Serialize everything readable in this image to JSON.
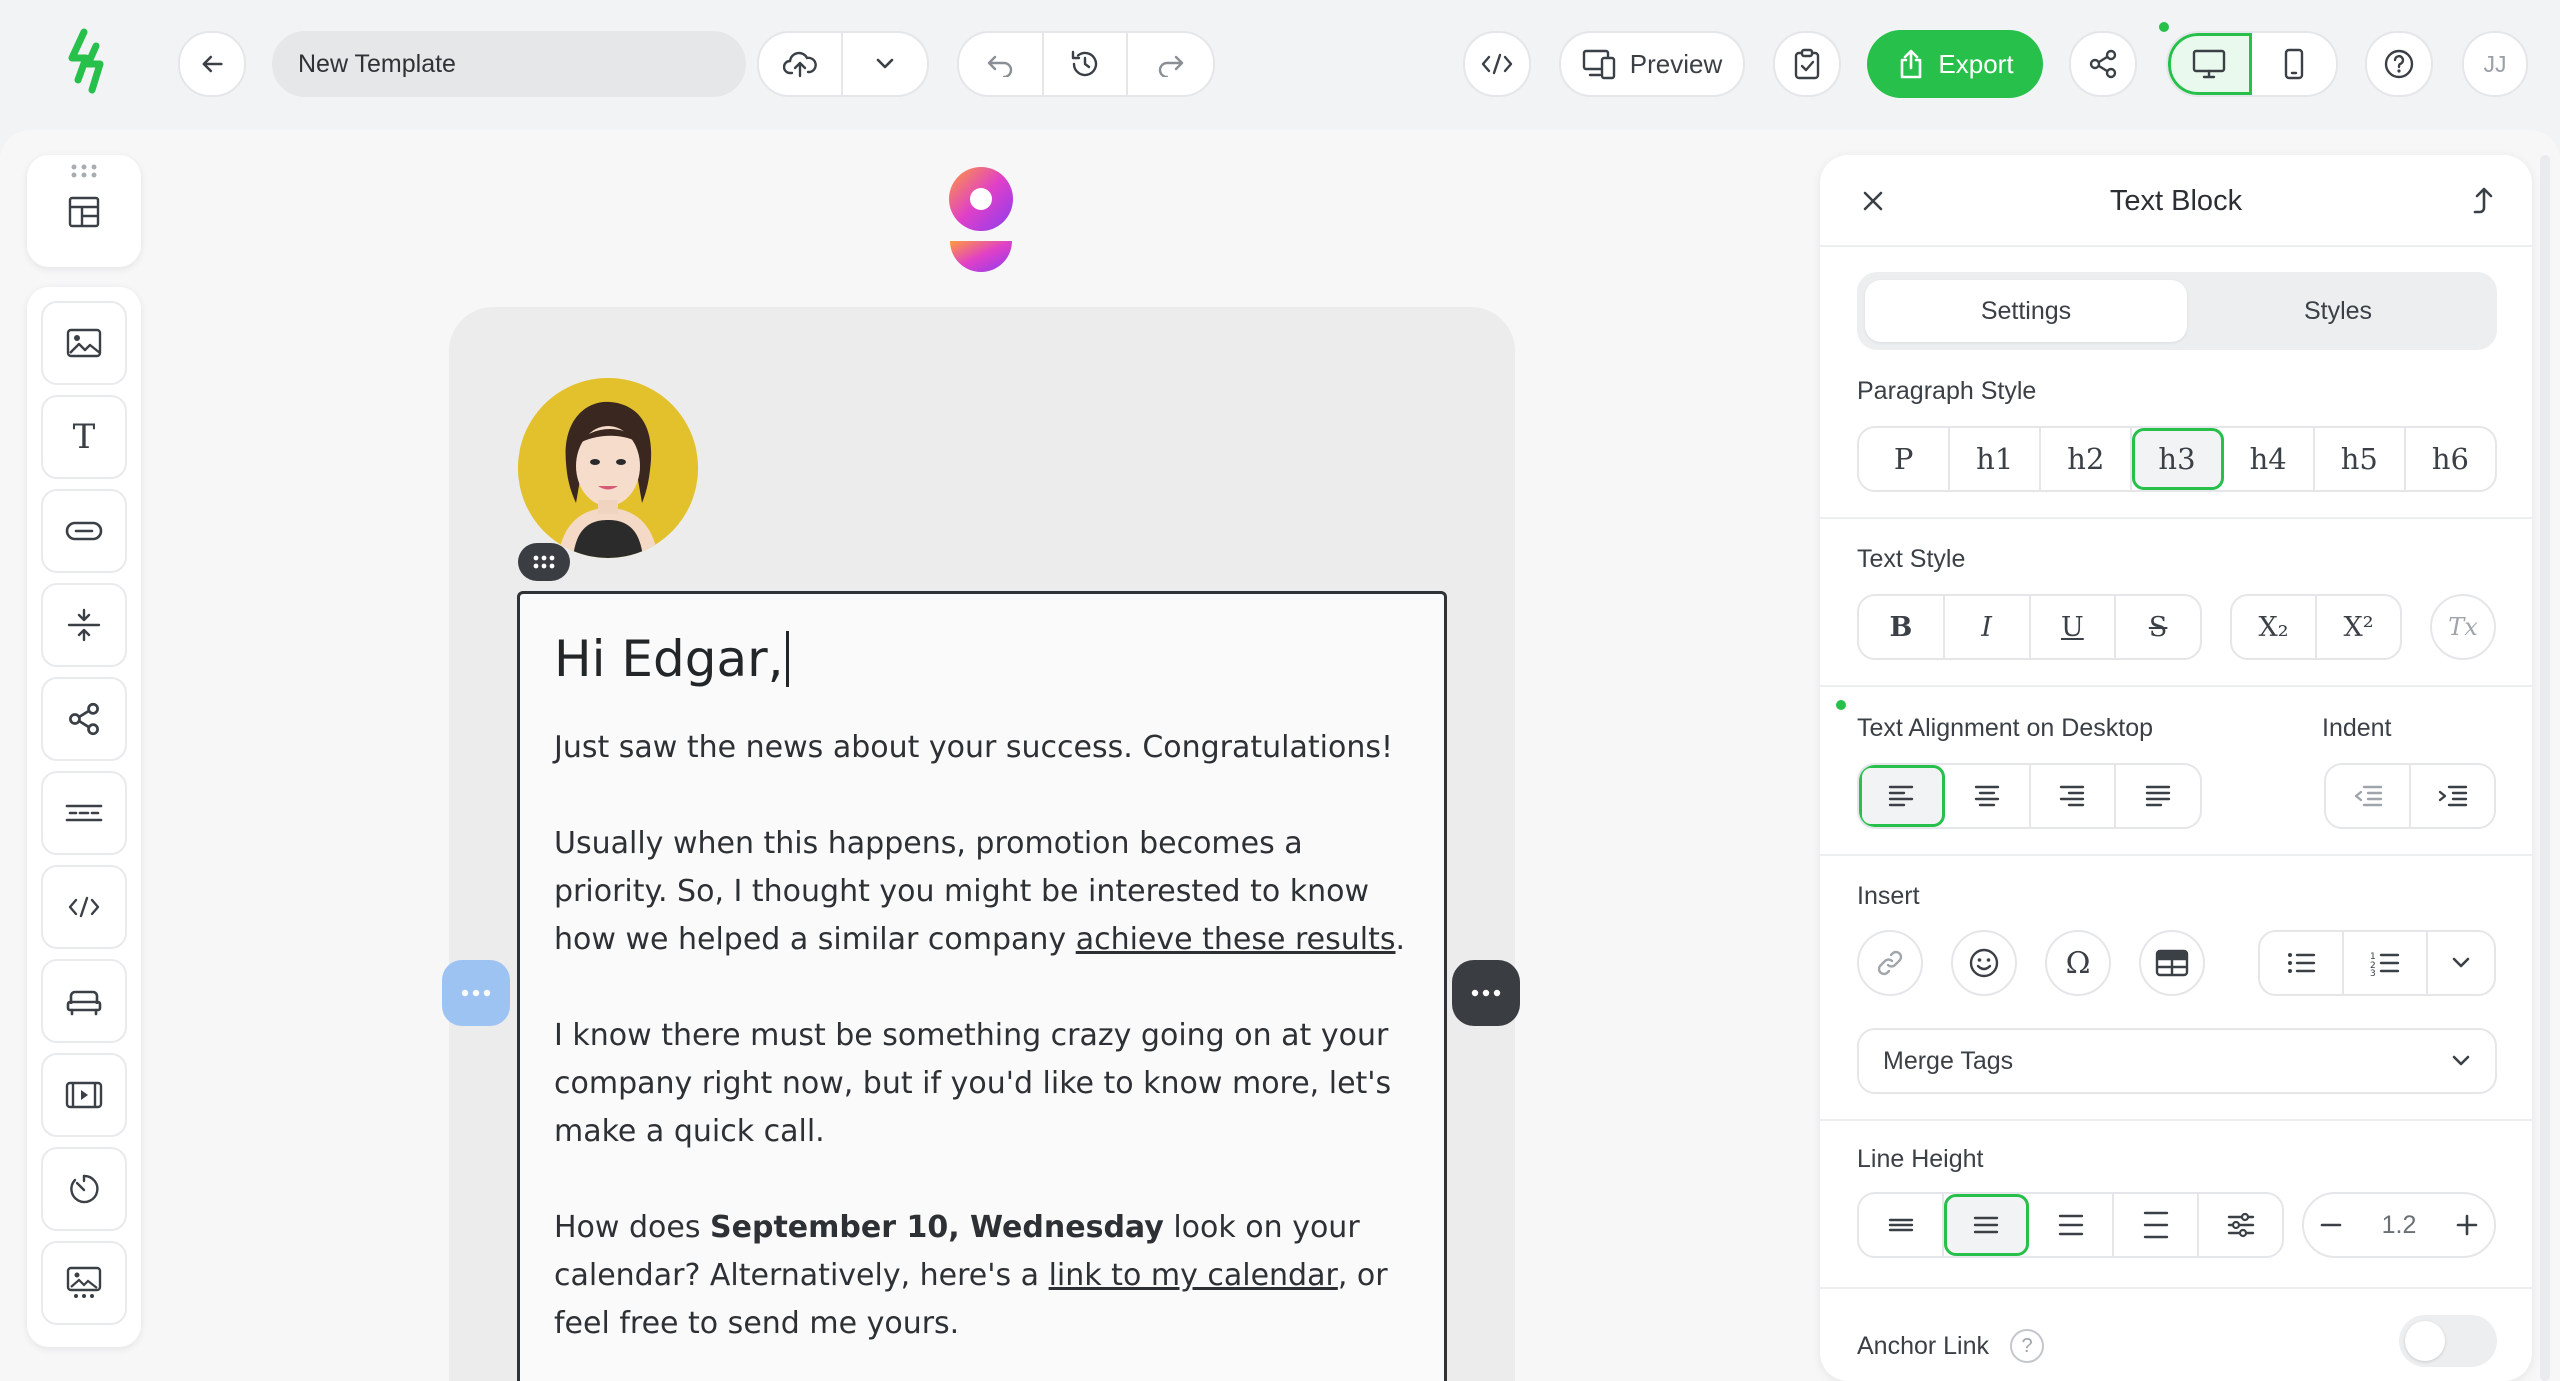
{
  "header": {
    "back_label": "back",
    "template_name": "New Template",
    "preview_label": "Preview",
    "export_label": "Export",
    "user_initials": "JJ"
  },
  "left_sidebar": {
    "items": [
      "layout-blocks",
      "image",
      "text",
      "button",
      "divider",
      "social",
      "menu",
      "html",
      "product",
      "video",
      "timer",
      "gallery"
    ]
  },
  "email": {
    "heading": "Hi Edgar,",
    "p1": "Just saw the news about your success. Congratulations!",
    "p2_a": "Usually when this happens, promotion becomes a priority. So, I thought you might be interested to know how we helped a similar company ",
    "p2_link": "achieve these results",
    "p2_b": ".",
    "p3": "I know there must be something crazy going on at your company right now, but if you'd like to know more, let's make a quick call.",
    "p4_a": "How does ",
    "p4_bold": "September 10, Wednesday",
    "p4_b": " look on your calendar? Alternatively, here's a ",
    "p4_link": "link to my calendar",
    "p4_c": ", or feel free to send me yours."
  },
  "panel": {
    "title": "Text Block",
    "tabs": [
      "Settings",
      "Styles"
    ],
    "active_tab": "Settings",
    "paragraph_style_label": "Paragraph Style",
    "paragraph_styles": [
      "P",
      "h1",
      "h2",
      "h3",
      "h4",
      "h5",
      "h6"
    ],
    "selected_paragraph_style": "h3",
    "text_style_label": "Text Style",
    "text_styles": [
      "B",
      "I",
      "U",
      "S"
    ],
    "script_styles": [
      "X₂",
      "X²"
    ],
    "clear_format": "Tx",
    "alignment_label": "Text Alignment on Desktop",
    "indent_label": "Indent",
    "insert_label": "Insert",
    "merge_tags_label": "Merge Tags",
    "line_height_label": "Line Height",
    "line_height_value": "1.2",
    "anchor_link_label": "Anchor Link",
    "anchor_link_help": "?"
  },
  "colors": {
    "accent_green": "#26c04b",
    "selection_blue": "#9dc3f2",
    "dark": "#3a3d41"
  }
}
